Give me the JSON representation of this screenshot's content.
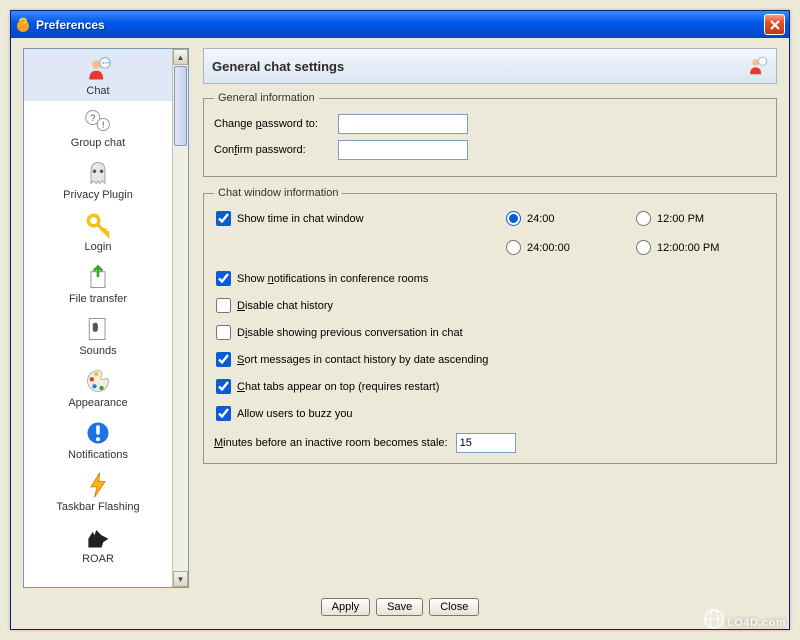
{
  "window": {
    "title": "Preferences"
  },
  "sidebar": {
    "items": [
      {
        "label": "Chat",
        "selected": true
      },
      {
        "label": "Group chat"
      },
      {
        "label": "Privacy Plugin"
      },
      {
        "label": "Login"
      },
      {
        "label": "File transfer"
      },
      {
        "label": "Sounds"
      },
      {
        "label": "Appearance"
      },
      {
        "label": "Notifications"
      },
      {
        "label": "Taskbar Flashing"
      },
      {
        "label": "ROAR"
      }
    ]
  },
  "page": {
    "title": "General chat settings"
  },
  "group_general": {
    "legend": "General information",
    "change_pw_label_pre": "Change ",
    "change_pw_label_u": "p",
    "change_pw_label_post": "assword to:",
    "change_pw_value": "",
    "confirm_pw_label_pre": "Con",
    "confirm_pw_label_u": "f",
    "confirm_pw_label_post": "irm password:",
    "confirm_pw_value": ""
  },
  "group_chat": {
    "legend": "Chat window information",
    "show_time_label": "Show time in chat window",
    "show_time_checked": true,
    "time_format": {
      "opt1": "24:00",
      "opt2": "12:00 PM",
      "opt3": "24:00:00",
      "opt4": "12:00:00 PM",
      "selected": "opt1"
    },
    "show_notifications_pre": "Show ",
    "show_notifications_u": "n",
    "show_notifications_post": "otifications in conference rooms",
    "show_notifications_checked": true,
    "disable_history_u": "D",
    "disable_history_post": "isable chat history",
    "disable_history_checked": false,
    "disable_prev_pre": "D",
    "disable_prev_u": "i",
    "disable_prev_post": "sable showing previous conversation in chat",
    "disable_prev_checked": false,
    "sort_msgs_pre": "",
    "sort_msgs_u": "S",
    "sort_msgs_post": "ort messages in contact history by date ascending",
    "sort_msgs_checked": true,
    "tabs_top_pre": "",
    "tabs_top_u": "C",
    "tabs_top_post": "hat tabs appear on top (requires restart)",
    "tabs_top_checked": true,
    "allow_buzz_label": "Allow users to buzz you",
    "allow_buzz_checked": true,
    "stale_label_u": "M",
    "stale_label_post": "inutes before an inactive room becomes stale:",
    "stale_value": "15"
  },
  "buttons": {
    "apply": "Apply",
    "save": "Save",
    "close": "Close"
  },
  "watermark": "LO4D.com"
}
